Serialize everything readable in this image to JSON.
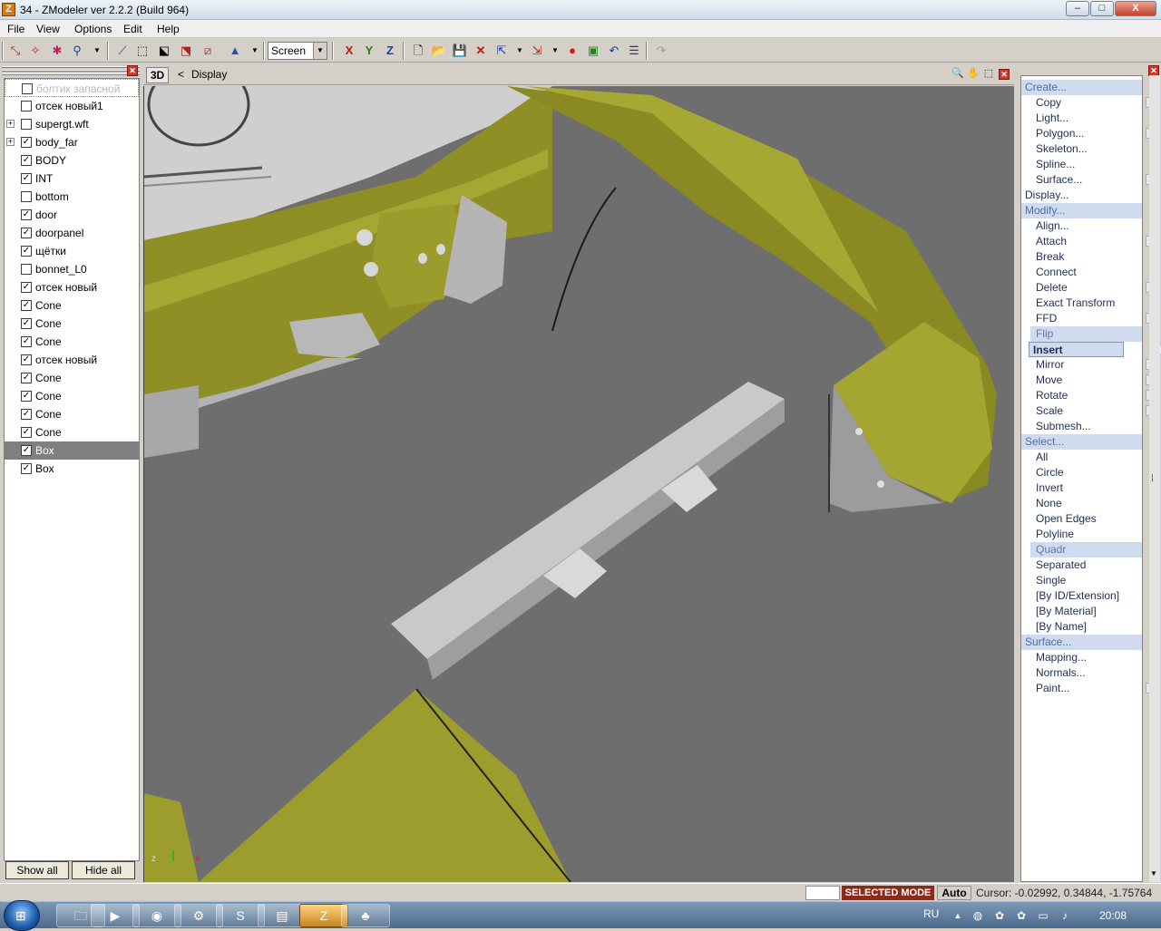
{
  "window": {
    "title": "34 - ZModeler ver 2.2.2 (Build 964)",
    "logo": "Z",
    "minimize": "–",
    "maximize": "□",
    "close": "X"
  },
  "menu": [
    {
      "label": "File"
    },
    {
      "label": "View"
    },
    {
      "label": "Options"
    },
    {
      "label": "Edit"
    },
    {
      "label": "Help"
    }
  ],
  "toolbar": {
    "screen_select": "Screen",
    "axis_x": "X",
    "axis_y": "Y",
    "axis_z": "Z"
  },
  "left_panel": {
    "tree": [
      {
        "label": "болтик запасной",
        "checked": false,
        "expandable": false,
        "faded": true
      },
      {
        "label": "отсек новый1",
        "checked": false,
        "expandable": false
      },
      {
        "label": "supergt.wft",
        "checked": false,
        "expandable": true
      },
      {
        "label": "body_far",
        "checked": true,
        "expandable": true
      },
      {
        "label": "BODY",
        "checked": true,
        "expandable": false
      },
      {
        "label": "INT",
        "checked": true,
        "expandable": false
      },
      {
        "label": "bottom",
        "checked": false,
        "expandable": false
      },
      {
        "label": "door",
        "checked": true,
        "expandable": false
      },
      {
        "label": "doorpanel",
        "checked": true,
        "expandable": false
      },
      {
        "label": "щётки",
        "checked": true,
        "expandable": false
      },
      {
        "label": "bonnet_L0",
        "checked": false,
        "expandable": false
      },
      {
        "label": "отсек новый",
        "checked": true,
        "expandable": false
      },
      {
        "label": "Cone",
        "checked": true,
        "expandable": false
      },
      {
        "label": "Cone",
        "checked": true,
        "expandable": false
      },
      {
        "label": "Cone",
        "checked": true,
        "expandable": false
      },
      {
        "label": "отсек новый",
        "checked": true,
        "expandable": false
      },
      {
        "label": "Cone",
        "checked": true,
        "expandable": false
      },
      {
        "label": "Cone",
        "checked": true,
        "expandable": false
      },
      {
        "label": "Cone",
        "checked": true,
        "expandable": false
      },
      {
        "label": "Cone",
        "checked": true,
        "expandable": false
      },
      {
        "label": "Box",
        "checked": true,
        "expandable": false,
        "selected": true
      },
      {
        "label": "Box",
        "checked": true,
        "expandable": false
      }
    ],
    "show_all": "Show all",
    "hide_all": "Hide all"
  },
  "viewport": {
    "mode": "3D",
    "back": "<",
    "label": "Display",
    "axis_z": "z",
    "axis_x": "x"
  },
  "right_panel": {
    "items": [
      {
        "label": "Create...",
        "kind": "head"
      },
      {
        "label": "Copy",
        "kind": "sub",
        "box": true
      },
      {
        "label": "Light...",
        "kind": "sub"
      },
      {
        "label": "Polygon...",
        "kind": "sub",
        "box": true
      },
      {
        "label": "Skeleton...",
        "kind": "sub"
      },
      {
        "label": "Spline...",
        "kind": "sub"
      },
      {
        "label": "Surface...",
        "kind": "sub",
        "box": true
      },
      {
        "label": "Display...",
        "kind": "cat"
      },
      {
        "label": "Modify...",
        "kind": "head"
      },
      {
        "label": "Align...",
        "kind": "sub"
      },
      {
        "label": "Attach",
        "kind": "sub",
        "box": true
      },
      {
        "label": "Break",
        "kind": "sub"
      },
      {
        "label": "Connect",
        "kind": "sub"
      },
      {
        "label": "Delete",
        "kind": "sub",
        "box": true
      },
      {
        "label": "Exact Transform",
        "kind": "sub"
      },
      {
        "label": "FFD",
        "kind": "sub",
        "box": true
      },
      {
        "label": "Flip",
        "kind": "hl"
      },
      {
        "label": "Insert",
        "kind": "insert",
        "box": true
      },
      {
        "label": "Mirror",
        "kind": "sub",
        "box": true
      },
      {
        "label": "Move",
        "kind": "sub",
        "box": true
      },
      {
        "label": "Rotate",
        "kind": "sub",
        "box": true
      },
      {
        "label": "Scale",
        "kind": "sub",
        "box": true
      },
      {
        "label": "Submesh...",
        "kind": "sub"
      },
      {
        "label": "Select...",
        "kind": "head"
      },
      {
        "label": "All",
        "kind": "sub"
      },
      {
        "label": "Circle",
        "kind": "sub"
      },
      {
        "label": "Invert",
        "kind": "sub"
      },
      {
        "label": "None",
        "kind": "sub"
      },
      {
        "label": "Open Edges",
        "kind": "sub"
      },
      {
        "label": "Polyline",
        "kind": "sub"
      },
      {
        "label": "Quadr",
        "kind": "hl"
      },
      {
        "label": "Separated",
        "kind": "sub"
      },
      {
        "label": "Single",
        "kind": "sub"
      },
      {
        "label": "[By ID/Extension]",
        "kind": "sub"
      },
      {
        "label": "[By Material]",
        "kind": "sub"
      },
      {
        "label": "[By Name]",
        "kind": "sub"
      },
      {
        "label": "Surface...",
        "kind": "head"
      },
      {
        "label": "Mapping...",
        "kind": "sub"
      },
      {
        "label": "Normals...",
        "kind": "sub"
      },
      {
        "label": "Paint...",
        "kind": "sub",
        "box": true
      }
    ]
  },
  "status": {
    "mode": "SELECTED MODE",
    "auto": "Auto",
    "cursor": "Cursor: -0.02992, 0.34844, -1.75764"
  },
  "taskbar": {
    "lang": "RU",
    "time": "20:08"
  },
  "colors": {
    "olive": "#9a9a2a",
    "selected_mode_bg": "#8c2a1a",
    "viewport_bg": "#6e6e6e"
  }
}
